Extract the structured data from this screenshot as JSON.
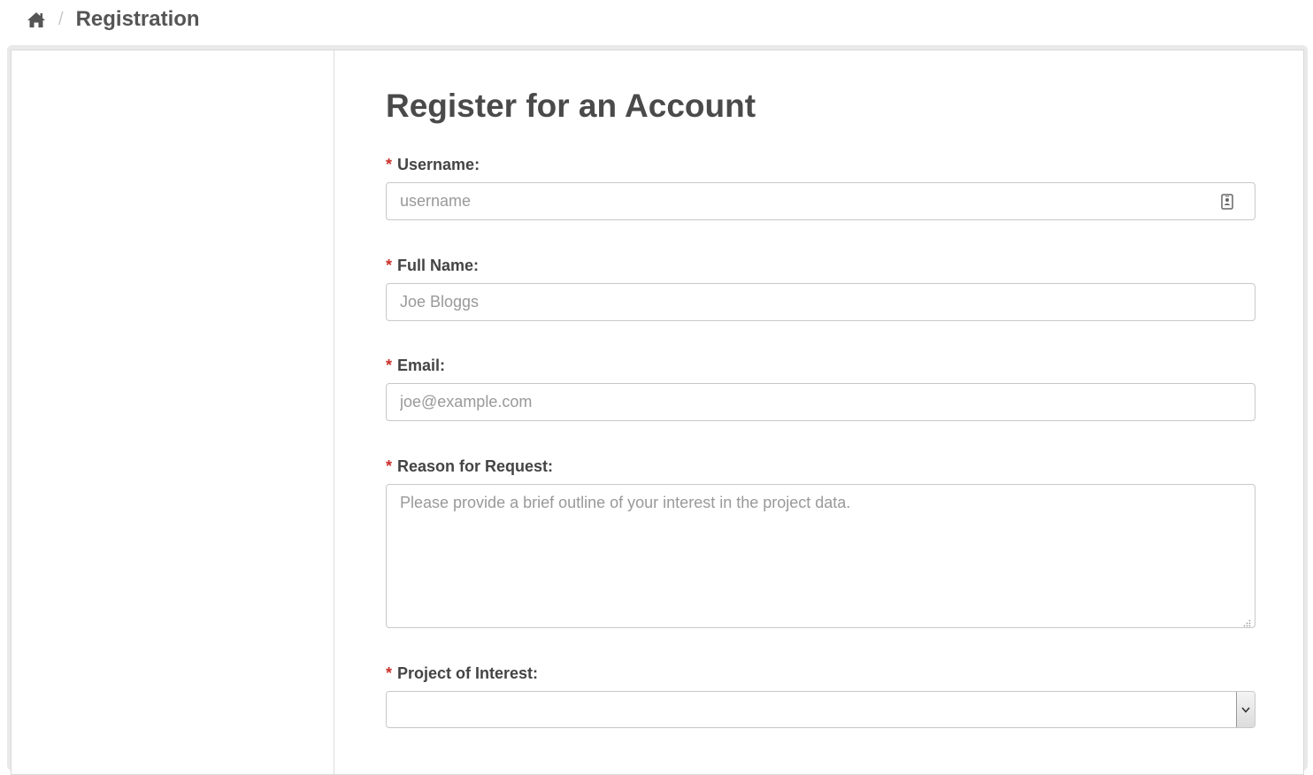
{
  "breadcrumb": {
    "home_icon": "home-icon",
    "separator": "/",
    "current": "Registration"
  },
  "form": {
    "title": "Register for an Account",
    "required_marker": "*",
    "username": {
      "label": "Username:",
      "placeholder": "username",
      "value": "",
      "icon": "contact-card-icon"
    },
    "full_name": {
      "label": "Full Name:",
      "placeholder": "Joe Bloggs",
      "value": ""
    },
    "email": {
      "label": "Email:",
      "placeholder": "joe@example.com",
      "value": ""
    },
    "reason": {
      "label": "Reason for Request:",
      "placeholder": "Please provide a brief outline of your interest in the project data.",
      "value": ""
    },
    "project": {
      "label": "Project of Interest:",
      "selected": "",
      "icon": "chevron-down-icon"
    }
  },
  "colors": {
    "required": "#c9302c",
    "border": "#c8c8c8",
    "text": "#444444"
  }
}
